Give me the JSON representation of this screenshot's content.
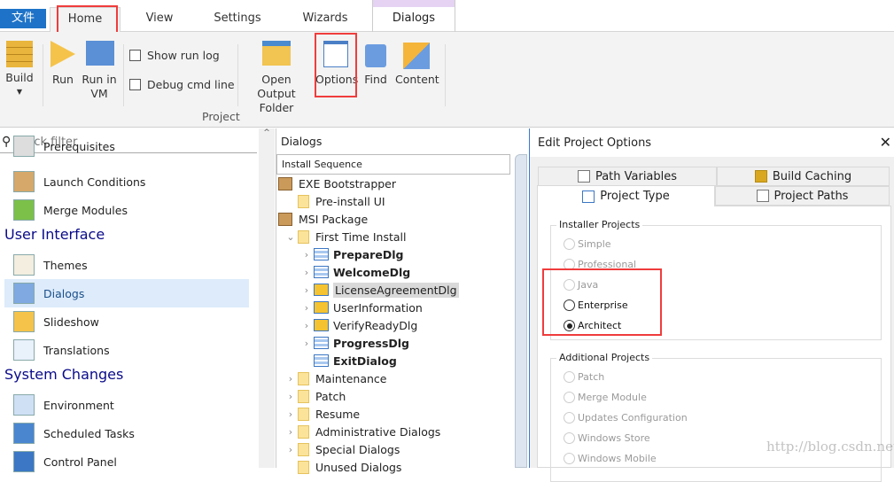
{
  "ribbon": {
    "file_tab": "文件",
    "tabs": [
      "Home",
      "View",
      "Settings",
      "Wizards"
    ],
    "context_tab": "Dialogs",
    "buttons": {
      "build": "Build",
      "run": "Run",
      "run_vm": "Run in VM",
      "open_output": "Open Output Folder",
      "options": "Options",
      "find": "Find",
      "content": "Content"
    },
    "checkboxes": [
      {
        "label": "Show run log",
        "checked": false
      },
      {
        "label": "Debug cmd line",
        "checked": false
      }
    ],
    "group_label": "Project"
  },
  "left": {
    "filter_placeholder": "Quick filter",
    "items": [
      {
        "label": "Prerequisites",
        "icon": "prerequisites-icon"
      },
      {
        "label": "Launch Conditions",
        "icon": "box-question-icon"
      },
      {
        "label": "Merge Modules",
        "icon": "merge-modules-icon"
      },
      {
        "header": "User Interface"
      },
      {
        "label": "Themes",
        "icon": "palette-icon"
      },
      {
        "label": "Dialogs",
        "icon": "dialog-icon",
        "selected": true
      },
      {
        "label": "Slideshow",
        "icon": "slideshow-icon"
      },
      {
        "label": "Translations",
        "icon": "translate-icon"
      },
      {
        "header": "System Changes"
      },
      {
        "label": "Environment",
        "icon": "environment-icon"
      },
      {
        "label": "Scheduled Tasks",
        "icon": "clock-icon"
      },
      {
        "label": "Control Panel",
        "icon": "control-panel-icon"
      }
    ]
  },
  "mid": {
    "title": "Dialogs",
    "sequence": "Install Sequence",
    "tree": [
      {
        "label": "EXE Bootstrapper",
        "level": 0,
        "icon": "package",
        "arrow": ""
      },
      {
        "label": "Pre-install UI",
        "level": 1,
        "icon": "folder",
        "arrow": ""
      },
      {
        "label": "MSI Package",
        "level": 0,
        "icon": "package",
        "arrow": ""
      },
      {
        "label": "First Time Install",
        "level": 1,
        "icon": "folder",
        "arrow": "v"
      },
      {
        "label": "PrepareDlg",
        "level": 2,
        "icon": "dialog",
        "arrow": ">",
        "bold": true
      },
      {
        "label": "WelcomeDlg",
        "level": 2,
        "icon": "dialog",
        "arrow": ">",
        "bold": true
      },
      {
        "label": "LicenseAgreementDlg",
        "level": 2,
        "icon": "dialog-warn",
        "arrow": ">",
        "selected": true
      },
      {
        "label": "UserInformation",
        "level": 2,
        "icon": "dialog-warn",
        "arrow": ">"
      },
      {
        "label": "VerifyReadyDlg",
        "level": 2,
        "icon": "dialog-warn",
        "arrow": ">"
      },
      {
        "label": "ProgressDlg",
        "level": 2,
        "icon": "dialog",
        "arrow": ">",
        "bold": true
      },
      {
        "label": "ExitDialog",
        "level": 2,
        "icon": "dialog",
        "arrow": "",
        "bold": true
      },
      {
        "label": "Maintenance",
        "level": 1,
        "icon": "folder",
        "arrow": ">"
      },
      {
        "label": "Patch",
        "level": 1,
        "icon": "folder",
        "arrow": ">"
      },
      {
        "label": "Resume",
        "level": 1,
        "icon": "folder",
        "arrow": ">"
      },
      {
        "label": "Administrative Dialogs",
        "level": 1,
        "icon": "folder",
        "arrow": ">"
      },
      {
        "label": "Special Dialogs",
        "level": 1,
        "icon": "folder",
        "arrow": ">"
      },
      {
        "label": "Unused Dialogs",
        "level": 1,
        "icon": "folder",
        "arrow": ""
      }
    ]
  },
  "dialog": {
    "title": "Edit Project Options",
    "tabs": [
      "Path Variables",
      "Build Caching",
      "Project Type",
      "Project Paths"
    ],
    "active_tab": "Project Type",
    "installer_group": "Installer Projects",
    "installer": [
      {
        "label": "Simple",
        "enabled": false
      },
      {
        "label": "Professional",
        "enabled": false
      },
      {
        "label": "Java",
        "enabled": false
      },
      {
        "label": "Enterprise",
        "enabled": true
      },
      {
        "label": "Architect",
        "enabled": true,
        "checked": true
      }
    ],
    "additional_group": "Additional Projects",
    "additional": [
      {
        "label": "Patch"
      },
      {
        "label": "Merge Module"
      },
      {
        "label": "Updates Configuration"
      },
      {
        "label": "Windows Store"
      },
      {
        "label": "Windows Mobile"
      }
    ]
  },
  "watermark": "http://blog.csdn.net/Sabrina_TSM",
  "colors": {
    "accent": "#1e73c8",
    "highlight": "#f03c3c",
    "selection": "#ddebfb"
  }
}
